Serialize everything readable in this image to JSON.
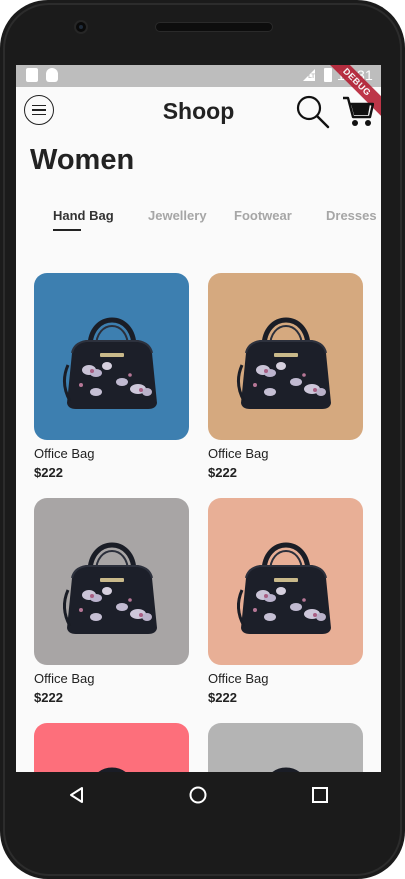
{
  "status_bar": {
    "time": "12:31",
    "network": "LTE",
    "debug_banner": "DEBUG"
  },
  "app_bar": {
    "title": "Shoop",
    "menu_icon": "menu-icon",
    "search_icon": "search-icon",
    "cart_icon": "cart-icon"
  },
  "page": {
    "heading": "Women"
  },
  "tabs": [
    {
      "label": "Hand Bag",
      "active": true
    },
    {
      "label": "Jewellery",
      "active": false
    },
    {
      "label": "Footwear",
      "active": false
    },
    {
      "label": "Dresses",
      "active": false
    }
  ],
  "products": [
    {
      "name": "Office Bag",
      "price": "$222",
      "bg_color": "#3d7fb0"
    },
    {
      "name": "Office Bag",
      "price": "$222",
      "bg_color": "#d5a97f"
    },
    {
      "name": "Office Bag",
      "price": "$222",
      "bg_color": "#a8a5a5"
    },
    {
      "name": "Office Bag",
      "price": "$222",
      "bg_color": "#e8af96"
    },
    {
      "name": "",
      "price": "",
      "bg_color": "#fd6f7b"
    },
    {
      "name": "",
      "price": "",
      "bg_color": "#b4b4b4"
    }
  ],
  "nav_bar": {
    "back_icon": "back-icon",
    "home_icon": "home-icon",
    "recents_icon": "recents-icon"
  }
}
